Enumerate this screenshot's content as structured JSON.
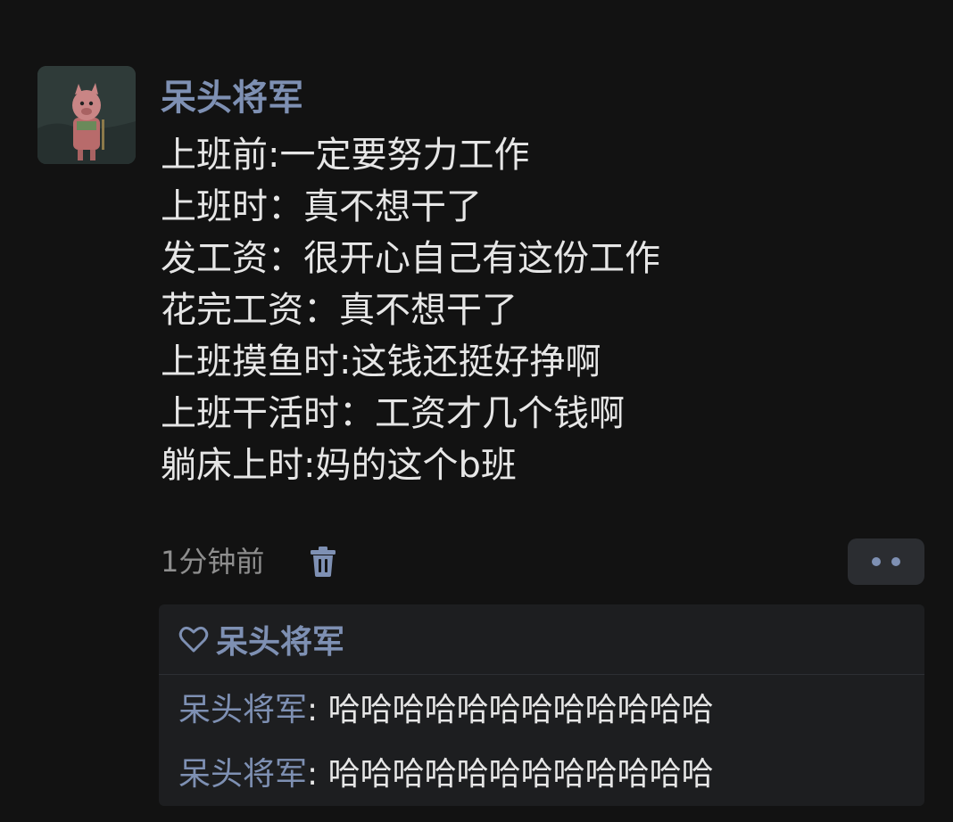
{
  "post": {
    "author": "呆头将军",
    "lines": [
      "上班前:一定要努力工作",
      "上班时：真不想干了",
      "发工资：很开心自己有这份工作",
      "花完工资：真不想干了",
      "上班摸鱼时:这钱还挺好挣啊",
      "上班干活时：工资才几个钱啊",
      "躺床上时:妈的这个b班"
    ],
    "time": "1分钟前"
  },
  "likes": {
    "names": "呆头将军"
  },
  "comments": [
    {
      "author": "呆头将军",
      "sep": ": ",
      "text": "哈哈哈哈哈哈哈哈哈哈哈哈"
    },
    {
      "author": "呆头将军",
      "sep": ": ",
      "text": "哈哈哈哈哈哈哈哈哈哈哈哈"
    }
  ],
  "colors": {
    "background": "#121212",
    "name_blue": "#7e90b3",
    "text": "#e6e6e6",
    "meta": "#8e8e8e",
    "panel": "#1d1e20"
  },
  "icons": {
    "delete": "trash-icon",
    "more": "more-dots-icon",
    "like": "heart-outline-icon"
  }
}
